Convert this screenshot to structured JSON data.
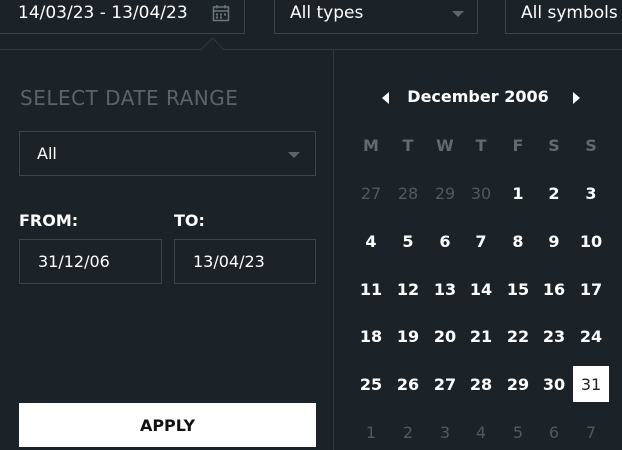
{
  "filters": {
    "date_range": "14/03/23 - 13/04/23",
    "type": "All types",
    "symbols": "All symbols"
  },
  "panel": {
    "title": "SELECT DATE RANGE",
    "preset": "All",
    "from_label": "FROM:",
    "to_label": "TO:",
    "from_value": "31/12/06",
    "to_value": "13/04/23",
    "apply_label": "APPLY"
  },
  "calendar": {
    "month_label": "December 2006",
    "weekdays": [
      "M",
      "T",
      "W",
      "T",
      "F",
      "S",
      "S"
    ],
    "weeks": [
      [
        "27",
        "28",
        "29",
        "30",
        "1",
        "2",
        "3"
      ],
      [
        "4",
        "5",
        "6",
        "7",
        "8",
        "9",
        "10"
      ],
      [
        "11",
        "12",
        "13",
        "14",
        "15",
        "16",
        "17"
      ],
      [
        "18",
        "19",
        "20",
        "21",
        "22",
        "23",
        "24"
      ],
      [
        "25",
        "26",
        "27",
        "28",
        "29",
        "30",
        "31"
      ],
      [
        "1",
        "2",
        "3",
        "4",
        "5",
        "6",
        "7"
      ]
    ],
    "muted_cells": [
      [
        0,
        0
      ],
      [
        0,
        1
      ],
      [
        0,
        2
      ],
      [
        0,
        3
      ],
      [
        5,
        0
      ],
      [
        5,
        1
      ],
      [
        5,
        2
      ],
      [
        5,
        3
      ],
      [
        5,
        4
      ],
      [
        5,
        5
      ],
      [
        5,
        6
      ]
    ],
    "selected_cell": [
      4,
      6
    ]
  },
  "colors": {
    "background": "#1b2328",
    "border": "#3a454c",
    "muted_text": "#4f5a61",
    "selected_bg": "#ffffff"
  },
  "icons": {
    "calendar": "calendar-icon",
    "dropdown": "chevron-down-icon",
    "prev": "chevron-left-icon",
    "next": "chevron-right-icon"
  }
}
